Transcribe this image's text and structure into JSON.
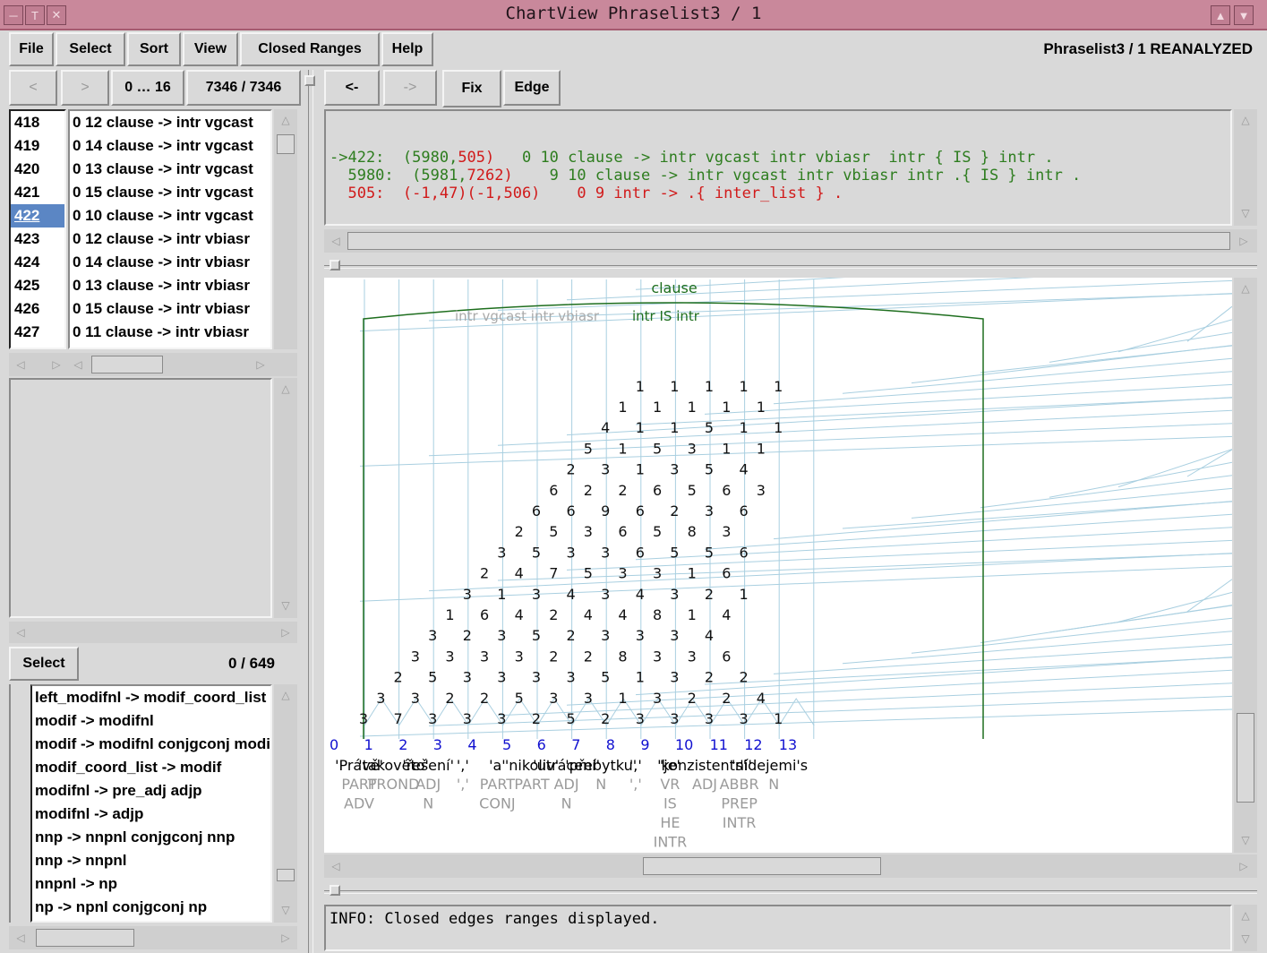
{
  "window": {
    "title": "ChartView Phraselist3 / 1",
    "status_right": "Phraselist3 / 1  REANALYZED"
  },
  "menu": [
    "File",
    "Select",
    "Sort",
    "View",
    "Closed Ranges",
    "Help"
  ],
  "nav": {
    "prev": "<",
    "next": ">",
    "range": "0 … 16",
    "count": "7346  /  7346"
  },
  "edge_toolbar": {
    "back": "<-",
    "forward": "->",
    "fix": "Fix",
    "edge": "Edge"
  },
  "phrase_list": {
    "numbers": [
      "418",
      "419",
      "420",
      "421",
      "422",
      "423",
      "424",
      "425",
      "426",
      "427"
    ],
    "selected_index": 4,
    "rules": [
      "0 12 clause -> intr vgcast",
      "0 14 clause -> intr vgcast",
      "0 13 clause -> intr vgcast",
      "0 15 clause -> intr vgcast",
      "0 10 clause -> intr vgcast",
      "0 12 clause -> intr vbiasr",
      "0 14 clause -> intr vbiasr",
      "0 13 clause -> intr vbiasr",
      "0 15 clause -> intr vbiasr",
      "0 11 clause -> intr vbiasr"
    ]
  },
  "rule_select": {
    "button": "Select",
    "count": "0  /  649"
  },
  "grammar_rules": [
    "left_modifnl -> modif_coord_list",
    "modif -> modifnl",
    "modif -> modifnl conjgconj modif",
    "modif_coord_list -> modif",
    "modifnl -> pre_adj adjp",
    "modifnl -> adjp",
    "nnp -> nnpnl conjgconj nnp",
    "nnp -> nnpnl",
    "nnpnl -> np",
    "np -> npnl conjgconj np"
  ],
  "edge_info": [
    {
      "prefix": "->422:  ",
      "ids": "(5980,",
      "rid": "505)",
      "rest": "   0 10 clause -> intr vgcast intr vbiasr  intr { IS } intr ."
    },
    {
      "prefix": "  5980:  ",
      "ids": "(5981,",
      "rid": "7262)",
      "rest": "    9 10 clause -> intr vgcast intr vbiasr intr .{ IS } intr ."
    },
    {
      "prefix": "  505:  ",
      "ids": "(-1,47)(-1,506)",
      "rid": "",
      "rest": "    0 9 intr -> .{ inter_list } ."
    }
  ],
  "chart": {
    "top_label": "clause",
    "rule_gray": "intr  vgcast  intr  vbiasr",
    "rule_green": "intr  IS  intr",
    "columns": [
      {
        "idx": "0",
        "word": "'Právě'",
        "tags": [
          "PART",
          "ADV"
        ]
      },
      {
        "idx": "1",
        "word": "'takovéto'",
        "tags": [
          "PROND"
        ]
      },
      {
        "idx": "2",
        "word": "'řešení'",
        "tags": [
          "ADJ",
          "N"
        ]
      },
      {
        "idx": "3",
        "word": "','",
        "tags": [
          "','"
        ]
      },
      {
        "idx": "4",
        "word": "'a'",
        "tags": [
          "PART",
          "CONJ"
        ]
      },
      {
        "idx": "5",
        "word": "'nikoliv'",
        "tags": [
          "PART"
        ]
      },
      {
        "idx": "6",
        "word": "'utrácení'",
        "tags": [
          "ADJ",
          "N"
        ]
      },
      {
        "idx": "7",
        "word": "'přebytku'",
        "tags": [
          "N"
        ]
      },
      {
        "idx": "8",
        "word": "','",
        "tags": [
          "','"
        ]
      },
      {
        "idx": "9",
        "word": "'je'",
        "tags": [
          "VR",
          "IS",
          "HE",
          "INTR"
        ]
      },
      {
        "idx": "10",
        "word": "'konzistentní'",
        "tags": [
          "ADJ"
        ]
      },
      {
        "idx": "11",
        "word": "'s'",
        "tags": [
          "ABBR",
          "PREP",
          "INTR"
        ]
      },
      {
        "idx": "12",
        "word": "'idejemi's",
        "tags": [
          "N"
        ]
      },
      {
        "idx": "13",
        "word": "",
        "tags": []
      }
    ],
    "labels": [
      {
        "c": "1",
        "t": "3"
      },
      {
        "c": "2",
        "t": "7"
      },
      {
        "c": "3",
        "t": "3"
      },
      {
        "c": "4",
        "t": "3"
      },
      {
        "c": "5",
        "t": "3"
      },
      {
        "c": "6",
        "t": "2"
      },
      {
        "c": "7",
        "t": "5"
      },
      {
        "c": "8",
        "t": "2"
      },
      {
        "c": "9",
        "t": "3"
      },
      {
        "c": "10",
        "t": "3"
      },
      {
        "c": "11",
        "t": "3"
      },
      {
        "c": "12",
        "t": "3"
      },
      {
        "c": "13",
        "t": "1"
      },
      {
        "c": "14",
        "t": "3"
      },
      {
        "c": "15",
        "t": "3"
      },
      {
        "c": "16",
        "t": "2"
      },
      {
        "c": "17",
        "t": "2"
      },
      {
        "c": "18",
        "t": "5"
      },
      {
        "c": "19",
        "t": "3"
      },
      {
        "c": "20",
        "t": "3"
      },
      {
        "c": "21",
        "t": "1"
      },
      {
        "c": "22",
        "t": "3"
      },
      {
        "c": "23",
        "t": "2"
      },
      {
        "c": "24",
        "t": "2"
      },
      {
        "c": "25",
        "t": "4"
      },
      {
        "c": "26",
        "t": "2"
      },
      {
        "c": "27",
        "t": "5"
      },
      {
        "c": "28",
        "t": "3"
      },
      {
        "c": "29",
        "t": "3"
      },
      {
        "c": "30",
        "t": "3"
      },
      {
        "c": "31",
        "t": "3"
      },
      {
        "c": "32",
        "t": "5"
      },
      {
        "c": "33",
        "t": "1"
      },
      {
        "c": "34",
        "t": "3"
      },
      {
        "c": "35",
        "t": "2"
      },
      {
        "c": "36",
        "t": "2"
      },
      {
        "c": "37",
        "t": "3"
      },
      {
        "c": "38",
        "t": "3"
      },
      {
        "c": "39",
        "t": "3"
      },
      {
        "c": "40",
        "t": "3"
      },
      {
        "c": "41",
        "t": "2"
      },
      {
        "c": "42",
        "t": "2"
      },
      {
        "c": "43",
        "t": "8"
      },
      {
        "c": "44",
        "t": "3"
      },
      {
        "c": "45",
        "t": "3"
      },
      {
        "c": "46",
        "t": "6"
      },
      {
        "c": "47",
        "t": "3"
      },
      {
        "c": "48",
        "t": "2"
      },
      {
        "c": "49",
        "t": "3"
      },
      {
        "c": "50",
        "t": "5"
      },
      {
        "c": "51",
        "t": "2"
      },
      {
        "c": "52",
        "t": "3"
      },
      {
        "c": "53",
        "t": "3"
      },
      {
        "c": "54",
        "t": "3"
      },
      {
        "c": "55",
        "t": "4"
      },
      {
        "c": "56",
        "t": "1"
      },
      {
        "c": "57",
        "t": "6"
      },
      {
        "c": "58",
        "t": "4"
      },
      {
        "c": "59",
        "t": "2"
      },
      {
        "c": "60",
        "t": "4"
      },
      {
        "c": "61",
        "t": "4"
      },
      {
        "c": "62",
        "t": "8"
      },
      {
        "c": "63",
        "t": "1"
      },
      {
        "c": "64",
        "t": "4"
      },
      {
        "c": "65",
        "t": "3"
      },
      {
        "c": "66",
        "t": "1"
      },
      {
        "c": "67",
        "t": "3"
      },
      {
        "c": "68",
        "t": "4"
      },
      {
        "c": "69",
        "t": "3"
      },
      {
        "c": "70",
        "t": "4"
      },
      {
        "c": "71",
        "t": "3"
      },
      {
        "c": "72",
        "t": "2"
      },
      {
        "c": "73",
        "t": "1"
      },
      {
        "c": "74",
        "t": "2"
      },
      {
        "c": "75",
        "t": "4"
      },
      {
        "c": "76",
        "t": "7"
      },
      {
        "c": "77",
        "t": "5"
      },
      {
        "c": "78",
        "t": "3"
      },
      {
        "c": "79",
        "t": "3"
      },
      {
        "c": "80",
        "t": "1"
      },
      {
        "c": "81",
        "t": "6"
      },
      {
        "c": "82",
        "t": "3"
      },
      {
        "c": "83",
        "t": "5"
      },
      {
        "c": "84",
        "t": "3"
      },
      {
        "c": "85",
        "t": "3"
      },
      {
        "c": "86",
        "t": "6"
      },
      {
        "c": "87",
        "t": "5"
      },
      {
        "c": "88",
        "t": "5"
      },
      {
        "c": "89",
        "t": "6"
      },
      {
        "c": "90",
        "t": "2"
      },
      {
        "c": "91",
        "t": "5"
      },
      {
        "c": "92",
        "t": "3"
      },
      {
        "c": "93",
        "t": "6"
      },
      {
        "c": "94",
        "t": "5"
      },
      {
        "c": "95",
        "t": "8"
      },
      {
        "c": "96",
        "t": "3"
      },
      {
        "c": "97",
        "t": "6"
      },
      {
        "c": "98",
        "t": "6"
      },
      {
        "c": "99",
        "t": "9"
      },
      {
        "c": "100",
        "t": "6"
      },
      {
        "c": "101",
        "t": "2"
      },
      {
        "c": "102",
        "t": "3"
      },
      {
        "c": "103",
        "t": "6"
      },
      {
        "c": "104",
        "t": "6"
      },
      {
        "c": "105",
        "t": "2"
      },
      {
        "c": "106",
        "t": "2"
      },
      {
        "c": "107",
        "t": "6"
      },
      {
        "c": "108",
        "t": "5"
      },
      {
        "c": "109",
        "t": "6"
      },
      {
        "c": "110",
        "t": "3"
      },
      {
        "c": "111",
        "t": "2"
      },
      {
        "c": "112",
        "t": "3"
      },
      {
        "c": "113",
        "t": "1"
      },
      {
        "c": "114",
        "t": "3"
      },
      {
        "c": "115",
        "t": "5"
      },
      {
        "c": "116",
        "t": "4"
      },
      {
        "c": "117",
        "t": "5"
      },
      {
        "c": "118",
        "t": "1"
      },
      {
        "c": "119",
        "t": "5"
      },
      {
        "c": "120",
        "t": "3"
      },
      {
        "c": "121",
        "t": "1"
      },
      {
        "c": "122",
        "t": "1"
      },
      {
        "c": "123",
        "t": "4"
      },
      {
        "c": "124",
        "t": "1"
      },
      {
        "c": "125",
        "t": "1"
      },
      {
        "c": "126",
        "t": "5"
      },
      {
        "c": "127",
        "t": "1"
      },
      {
        "c": "128",
        "t": "1"
      },
      {
        "c": "129",
        "t": "1"
      },
      {
        "c": "130",
        "t": "1"
      },
      {
        "c": "131",
        "t": "1"
      },
      {
        "c": "132",
        "t": "1"
      },
      {
        "c": "133",
        "t": "1"
      },
      {
        "c": "134",
        "t": "1"
      },
      {
        "c": "135",
        "t": "1"
      },
      {
        "c": "136",
        "t": "1"
      },
      {
        "c": "137",
        "t": "1"
      },
      {
        "c": "138",
        "t": "1"
      }
    ]
  },
  "status": "INFO:  Closed edges ranges displayed.",
  "colors": {
    "title_bar": "#c9889b",
    "selected": "#5b86c4",
    "edge_line": "#a9cfe0",
    "parse_line": "#1e6e1e",
    "index_blue": "#1010d0",
    "tag_gray": "#9a9a9a"
  }
}
